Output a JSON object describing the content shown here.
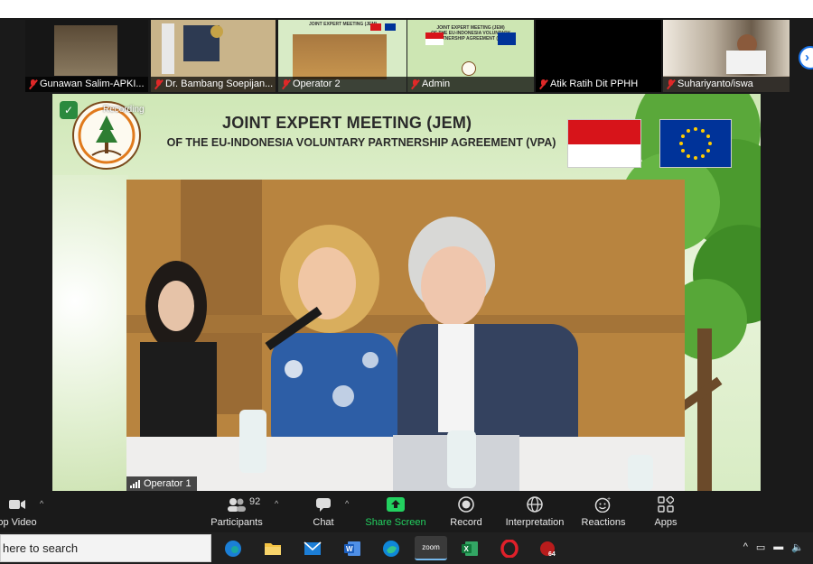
{
  "thumbnails": [
    {
      "name": "Gunawan Salim-APKI...",
      "bg": "#3a3226"
    },
    {
      "name": "Dr. Bambang Soepijan...",
      "bg": "#c9b48a"
    },
    {
      "name": "Operator 2",
      "bg": "#d8ebc6"
    },
    {
      "name": "Admin",
      "bg": "#cde6b3"
    },
    {
      "name": "Atik Ratih Dit PPHH",
      "bg": "#000000"
    },
    {
      "name": "Suhariyanto/iswa",
      "bg": "#b7aa98"
    }
  ],
  "stage": {
    "recording": "Recording",
    "title_line1": "JOINT EXPERT MEETING (JEM)",
    "title_line2": "OF THE EU-INDONESIA VOLUNTARY PARTNERSHIP AGREEMENT (VPA)",
    "speaker_label": "Operator 1"
  },
  "toolbar": {
    "video_label": "op Video",
    "participants_label": "Participants",
    "participants_count": "92",
    "chat_label": "Chat",
    "share_label": "Share Screen",
    "record_label": "Record",
    "interpretation_label": "Interpretation",
    "reactions_label": "Reactions",
    "apps_label": "Apps"
  },
  "taskbar": {
    "search_placeholder": "here to search",
    "apps": [
      "edge-browser",
      "file-explorer",
      "mail",
      "word",
      "edge",
      "zoom",
      "excel",
      "opera",
      "game"
    ],
    "zoom_label": "zoom",
    "badge": "64"
  },
  "colors": {
    "share_green": "#23d160",
    "mic_off": "#e02828",
    "flag_red": "#d7141a",
    "eu_blue": "#003399"
  }
}
